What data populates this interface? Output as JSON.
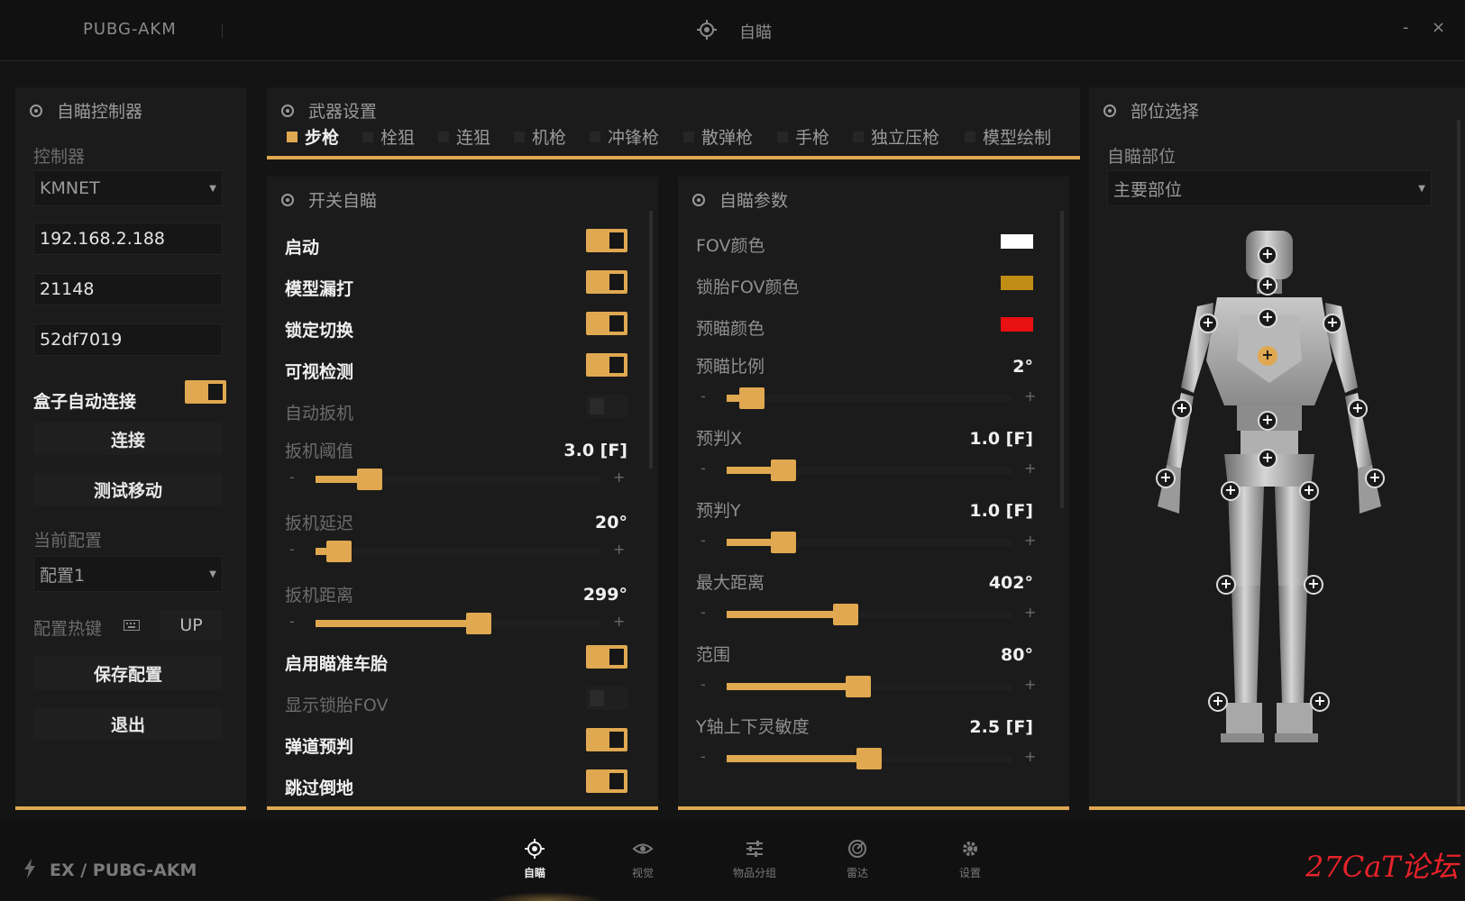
{
  "titlebar": {
    "app_name": "PUBG-AKM",
    "title": "自瞄",
    "minimize": "-",
    "close": "×"
  },
  "controller_panel": {
    "title": "自瞄控制器",
    "controller_label": "控制器",
    "controller_value": "KMNET",
    "ip": "192.168.2.188",
    "port": "21148",
    "uuid": "52df7019",
    "auto_connect_label": "盒子自动连接",
    "connect_button": "连接",
    "test_move_button": "测试移动",
    "current_config_label": "当前配置",
    "current_config_value": "配置1",
    "hotkey_label": "配置热键",
    "hotkey_value": "UP",
    "save_button": "保存配置",
    "exit_button": "退出"
  },
  "weapon_panel": {
    "title": "武器设置",
    "tabs": [
      {
        "label": "步枪",
        "active": true
      },
      {
        "label": "栓狙",
        "active": false
      },
      {
        "label": "连狙",
        "active": false
      },
      {
        "label": "机枪",
        "active": false
      },
      {
        "label": "冲锋枪",
        "active": false
      },
      {
        "label": "散弹枪",
        "active": false
      },
      {
        "label": "手枪",
        "active": false
      },
      {
        "label": "独立压枪",
        "active": false
      },
      {
        "label": "模型绘制",
        "active": false
      }
    ]
  },
  "switch_panel": {
    "title": "开关自瞄",
    "enable": {
      "label": "启动",
      "on": true
    },
    "model_penetration": {
      "label": "模型漏打",
      "on": true
    },
    "lock_switch": {
      "label": "锁定切换",
      "on": true
    },
    "visibility_check": {
      "label": "可视检测",
      "on": true
    },
    "auto_trigger": {
      "label": "自动扳机",
      "on": false
    },
    "trigger_threshold": {
      "label": "扳机阈值",
      "value": "3.0 [F]",
      "fraction": 0.16
    },
    "trigger_delay": {
      "label": "扳机延迟",
      "value": "20°",
      "fraction": 0.04
    },
    "trigger_distance": {
      "label": "扳机距离",
      "value": "299°",
      "fraction": 0.58
    },
    "aim_tires": {
      "label": "启用瞄准车胎",
      "on": true
    },
    "show_tire_fov": {
      "label": "显示锁胎FOV",
      "on": false
    },
    "ballistic_prediction": {
      "label": "弹道预判",
      "on": true
    },
    "skip_downed": {
      "label": "跳过倒地",
      "on": true
    },
    "minus": "-",
    "plus": "+"
  },
  "params_panel": {
    "title": "自瞄参数",
    "fov_color": {
      "label": "FOV颜色",
      "color": "#ffffff"
    },
    "tire_fov_color": {
      "label": "锁胎FOV颜色",
      "color": "#c08e14"
    },
    "pre_aim_color": {
      "label": "预瞄颜色",
      "color": "#e81010"
    },
    "pre_aim_ratio": {
      "label": "预瞄比例",
      "value": "2°",
      "fraction": 0.05
    },
    "predict_x": {
      "label": "预判X",
      "value": "1.0 [F]",
      "fraction": 0.17
    },
    "predict_y": {
      "label": "预判Y",
      "value": "1.0 [F]",
      "fraction": 0.17
    },
    "max_distance": {
      "label": "最大距离",
      "value": "402°",
      "fraction": 0.41
    },
    "range": {
      "label": "范围",
      "value": "80°",
      "fraction": 0.46
    },
    "y_sensitivity": {
      "label": "Y轴上下灵敏度",
      "value": "2.5 [F]",
      "fraction": 0.5
    },
    "minus": "-",
    "plus": "+"
  },
  "part_panel": {
    "title": "部位选择",
    "aim_part_label": "自瞄部位",
    "aim_part_value": "主要部位"
  },
  "footer": {
    "path": "EX / PUBG-AKM",
    "nav": [
      {
        "label": "自瞄",
        "icon": "crosshair-icon",
        "active": true
      },
      {
        "label": "视觉",
        "icon": "eye-icon",
        "active": false
      },
      {
        "label": "物品分组",
        "icon": "sliders-icon",
        "active": false
      },
      {
        "label": "雷达",
        "icon": "radar-icon",
        "active": false
      },
      {
        "label": "设置",
        "icon": "gear-icon",
        "active": false
      }
    ],
    "watermark": "27CaT论坛"
  },
  "colors": {
    "accent": "#e0a850",
    "background": "#141414",
    "panel": "#1b1b1b"
  }
}
